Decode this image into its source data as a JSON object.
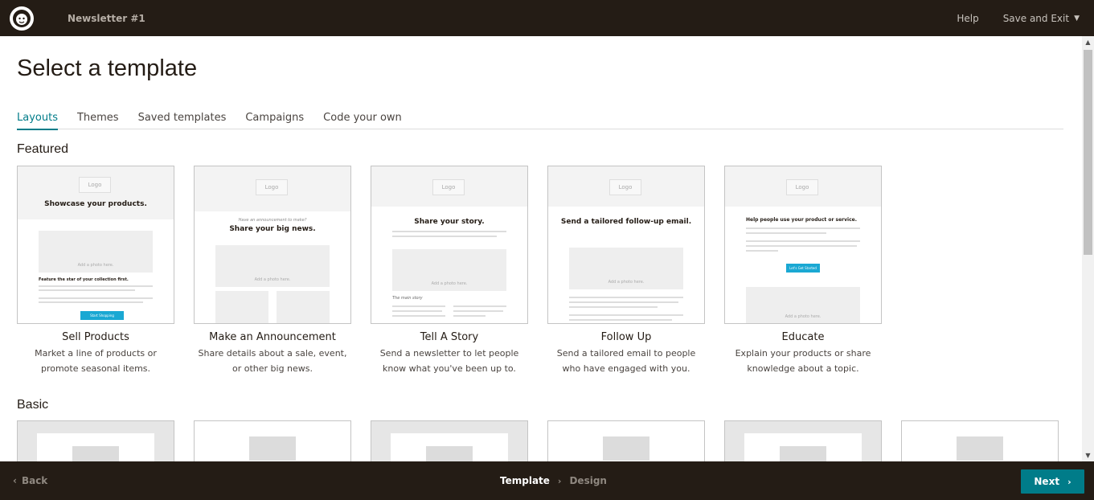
{
  "topbar": {
    "campaign_name": "Newsletter #1",
    "help_label": "Help",
    "save_exit_label": "Save and Exit"
  },
  "page": {
    "title": "Select a template"
  },
  "tabs": [
    {
      "label": "Layouts",
      "active": true
    },
    {
      "label": "Themes",
      "active": false
    },
    {
      "label": "Saved templates",
      "active": false
    },
    {
      "label": "Campaigns",
      "active": false
    },
    {
      "label": "Code your own",
      "active": false
    }
  ],
  "sections": {
    "featured_title": "Featured",
    "basic_title": "Basic"
  },
  "featured": [
    {
      "name": "Sell Products",
      "desc": "Market a line of products or promote seasonal items.",
      "thumb_logo": "Logo",
      "thumb_heading": "Showcase your products.",
      "thumb_photo": "Add a photo here.",
      "thumb_subheading": "Feature the star of your collection first.",
      "thumb_button": "Start Shopping"
    },
    {
      "name": "Make an Announcement",
      "desc": "Share details about a sale, event, or other big news.",
      "thumb_logo": "Logo",
      "thumb_kicker": "Have an announcement to make?",
      "thumb_heading": "Share your big news.",
      "thumb_photo": "Add a photo here."
    },
    {
      "name": "Tell A Story",
      "desc": "Send a newsletter to let people know what you've been up to.",
      "thumb_logo": "Logo",
      "thumb_heading": "Share your story.",
      "thumb_photo": "Add a photo here.",
      "thumb_subheading": "The main story"
    },
    {
      "name": "Follow Up",
      "desc": "Send a tailored email to people who have engaged with you.",
      "thumb_logo": "Logo",
      "thumb_heading": "Send a tailored follow-up email.",
      "thumb_photo": "Add a photo here."
    },
    {
      "name": "Educate",
      "desc": "Explain your products or share knowledge about a topic.",
      "thumb_logo": "Logo",
      "thumb_heading": "Help people use your product or service.",
      "thumb_button": "Let's Get Started",
      "thumb_photo": "Add a photo here."
    }
  ],
  "footer": {
    "back_label": "Back",
    "step_current": "Template",
    "step_next": "Design",
    "next_label": "Next"
  },
  "colors": {
    "topbar_bg": "#241c15",
    "accent": "#007c89",
    "thumb_button": "#1aa8d3"
  },
  "icons": {
    "logo": "freddie-monkey-icon",
    "save_exit_chevron": "chevron-down-icon",
    "back_arrow": "chevron-left-icon",
    "step_separator": "chevron-right-icon",
    "next_arrow": "chevron-right-icon"
  }
}
